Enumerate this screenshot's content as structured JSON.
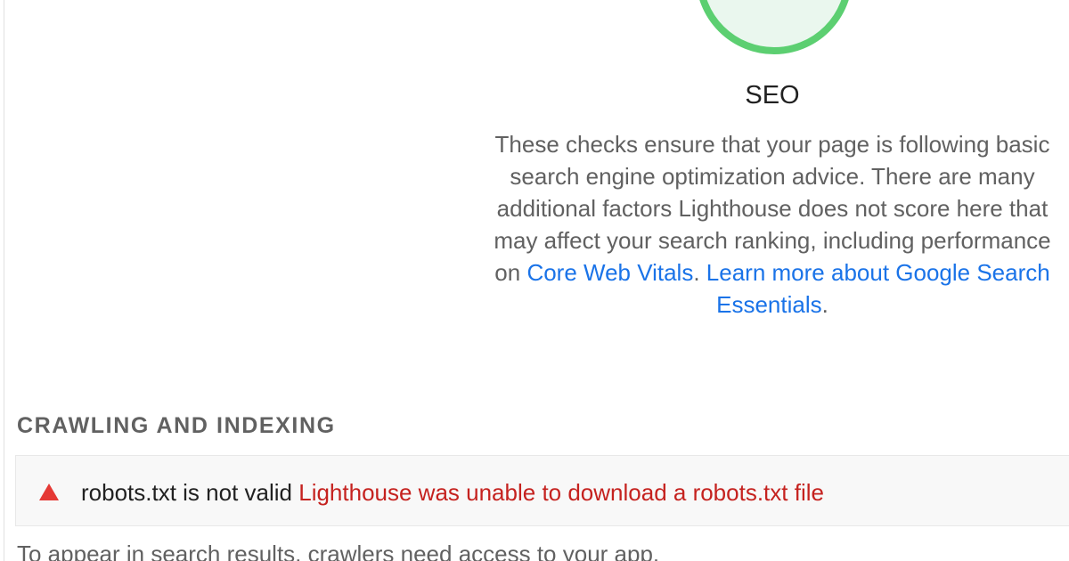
{
  "category": {
    "title": "SEO",
    "score_color": "#5ccf71",
    "description_lines": [
      "These checks ensure that your page is following basic",
      "search engine optimization advice. There are many",
      "additional factors Lighthouse does not score here that",
      "may affect your search ranking, including performance"
    ],
    "line5_prefix": "on ",
    "link_core_web_vitals": "Core Web Vitals",
    "line5_sep": ". ",
    "link_learn_more": "Learn more about Google Search",
    "link_learn_more_cont": "Essentials",
    "line6_suffix": "."
  },
  "group": {
    "title": "CRAWLING AND INDEXING"
  },
  "audit": {
    "status_icon": "fail-triangle-icon",
    "status_color": "#e53935",
    "title": "robots.txt is not valid",
    "display_value": "Lighthouse was unable to download a robots.txt file",
    "display_color": "#c5221f"
  },
  "group_description": "To appear in search results, crawlers need access to your app."
}
